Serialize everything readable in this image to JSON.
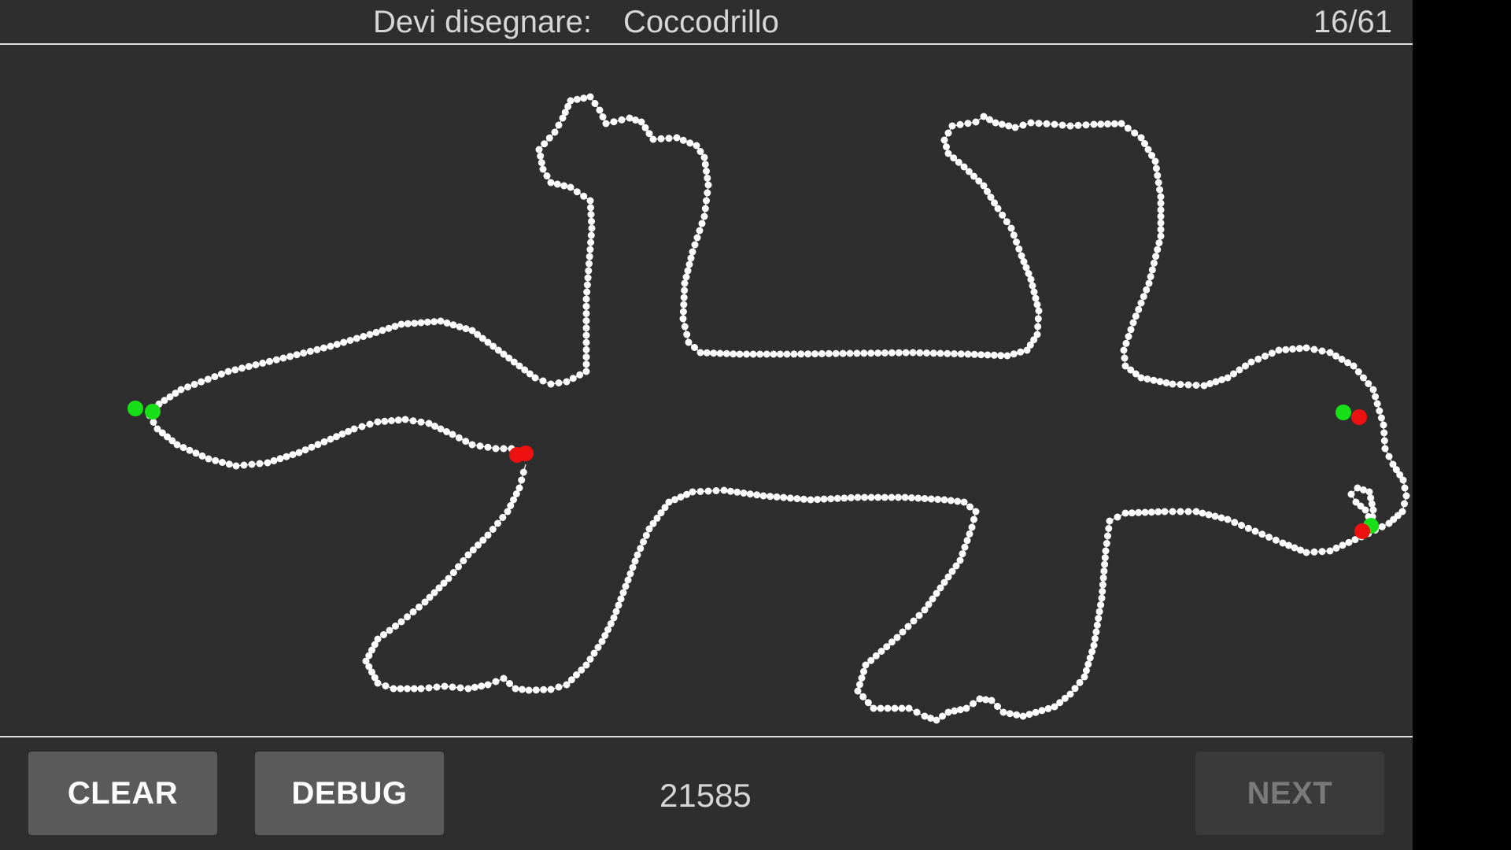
{
  "header": {
    "prompt_label": "Devi disegnare:",
    "prompt_word": "Coccodrillo",
    "progress": "16/61"
  },
  "footer": {
    "clear_label": "CLEAR",
    "debug_label": "DEBUG",
    "score": "21585",
    "next_label": "NEXT"
  },
  "colors": {
    "background": "#2e2e2e",
    "stroke": "#ffffff",
    "start_marker": "#18e018",
    "end_marker": "#ee1111"
  }
}
